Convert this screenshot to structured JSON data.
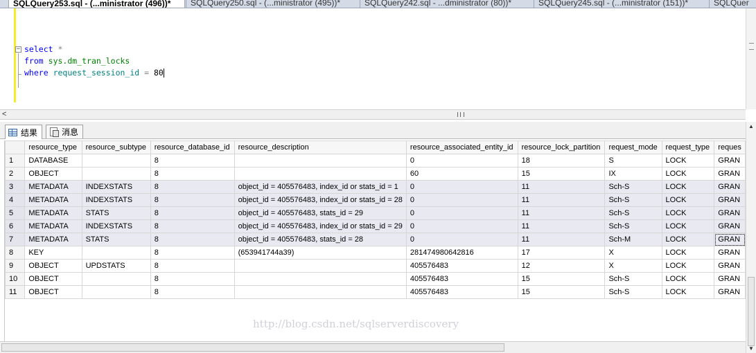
{
  "tabs": [
    {
      "label": "SQLQuery253.sql - (...ministrator (496))*",
      "active": true
    },
    {
      "label": "SQLQuery250.sql - (...ministrator (495))*",
      "active": false
    },
    {
      "label": "SQLQuery242.sql - ...dministrator (80))*",
      "active": false
    },
    {
      "label": "SQLQuery245.sql - (...ministrator (151))*",
      "active": false
    },
    {
      "label": "SQLQuer",
      "active": false
    }
  ],
  "editor": {
    "fold_symbol": "−",
    "line1": {
      "kw": "select",
      "rest": " *"
    },
    "line2": {
      "kw": "from",
      "obj": "sys.dm_tran_locks"
    },
    "line3": {
      "kw": "where",
      "ident": "request_session_id",
      "op": "=",
      "val": "80"
    }
  },
  "colors": {
    "keyword": "#0000ff",
    "object": "#008000",
    "identifier": "#008080",
    "highlight_row": "#e9e9f2"
  },
  "result_tabs": {
    "results": "结果",
    "messages": "消息"
  },
  "watermark": "http://blog.csdn.net/sqlserverdiscovery",
  "grid": {
    "columns": [
      "resource_type",
      "resource_subtype",
      "resource_database_id",
      "resource_description",
      "resource_associated_entity_id",
      "resource_lock_partition",
      "request_mode",
      "request_type",
      "reques"
    ],
    "rows": [
      {
        "n": "1",
        "cells": [
          "DATABASE",
          "",
          "8",
          "",
          "0",
          "18",
          "S",
          "LOCK",
          "GRAN"
        ]
      },
      {
        "n": "2",
        "cells": [
          "OBJECT",
          "",
          "8",
          "",
          "60",
          "15",
          "IX",
          "LOCK",
          "GRAN"
        ]
      },
      {
        "n": "3",
        "cells": [
          "METADATA",
          "INDEXSTATS",
          "8",
          "object_id = 405576483, index_id or stats_id = 1",
          "0",
          "11",
          "Sch-S",
          "LOCK",
          "GRAN"
        ]
      },
      {
        "n": "4",
        "cells": [
          "METADATA",
          "INDEXSTATS",
          "8",
          "object_id = 405576483, index_id or stats_id = 28",
          "0",
          "11",
          "Sch-S",
          "LOCK",
          "GRAN"
        ]
      },
      {
        "n": "5",
        "cells": [
          "METADATA",
          "STATS",
          "8",
          "object_id = 405576483, stats_id = 29",
          "0",
          "11",
          "Sch-S",
          "LOCK",
          "GRAN"
        ]
      },
      {
        "n": "6",
        "cells": [
          "METADATA",
          "INDEXSTATS",
          "8",
          "object_id = 405576483, index_id or stats_id = 29",
          "0",
          "11",
          "Sch-S",
          "LOCK",
          "GRAN"
        ]
      },
      {
        "n": "7",
        "cells": [
          "METADATA",
          "STATS",
          "8",
          "object_id = 405576483, stats_id = 28",
          "0",
          "11",
          "Sch-M",
          "LOCK",
          "GRAN"
        ]
      },
      {
        "n": "8",
        "cells": [
          "KEY",
          "",
          "8",
          "(653941744a39)",
          "281474980642816",
          "17",
          "X",
          "LOCK",
          "GRAN"
        ]
      },
      {
        "n": "9",
        "cells": [
          "OBJECT",
          "UPDSTATS",
          "8",
          "",
          "405576483",
          "12",
          "X",
          "LOCK",
          "GRAN"
        ]
      },
      {
        "n": "10",
        "cells": [
          "OBJECT",
          "",
          "8",
          "",
          "405576483",
          "15",
          "Sch-S",
          "LOCK",
          "GRAN"
        ]
      },
      {
        "n": "11",
        "cells": [
          "OBJECT",
          "",
          "8",
          "",
          "405576483",
          "15",
          "Sch-S",
          "LOCK",
          "GRAN"
        ]
      }
    ],
    "highlighted_rows": [
      3,
      4,
      5,
      6,
      7
    ]
  }
}
